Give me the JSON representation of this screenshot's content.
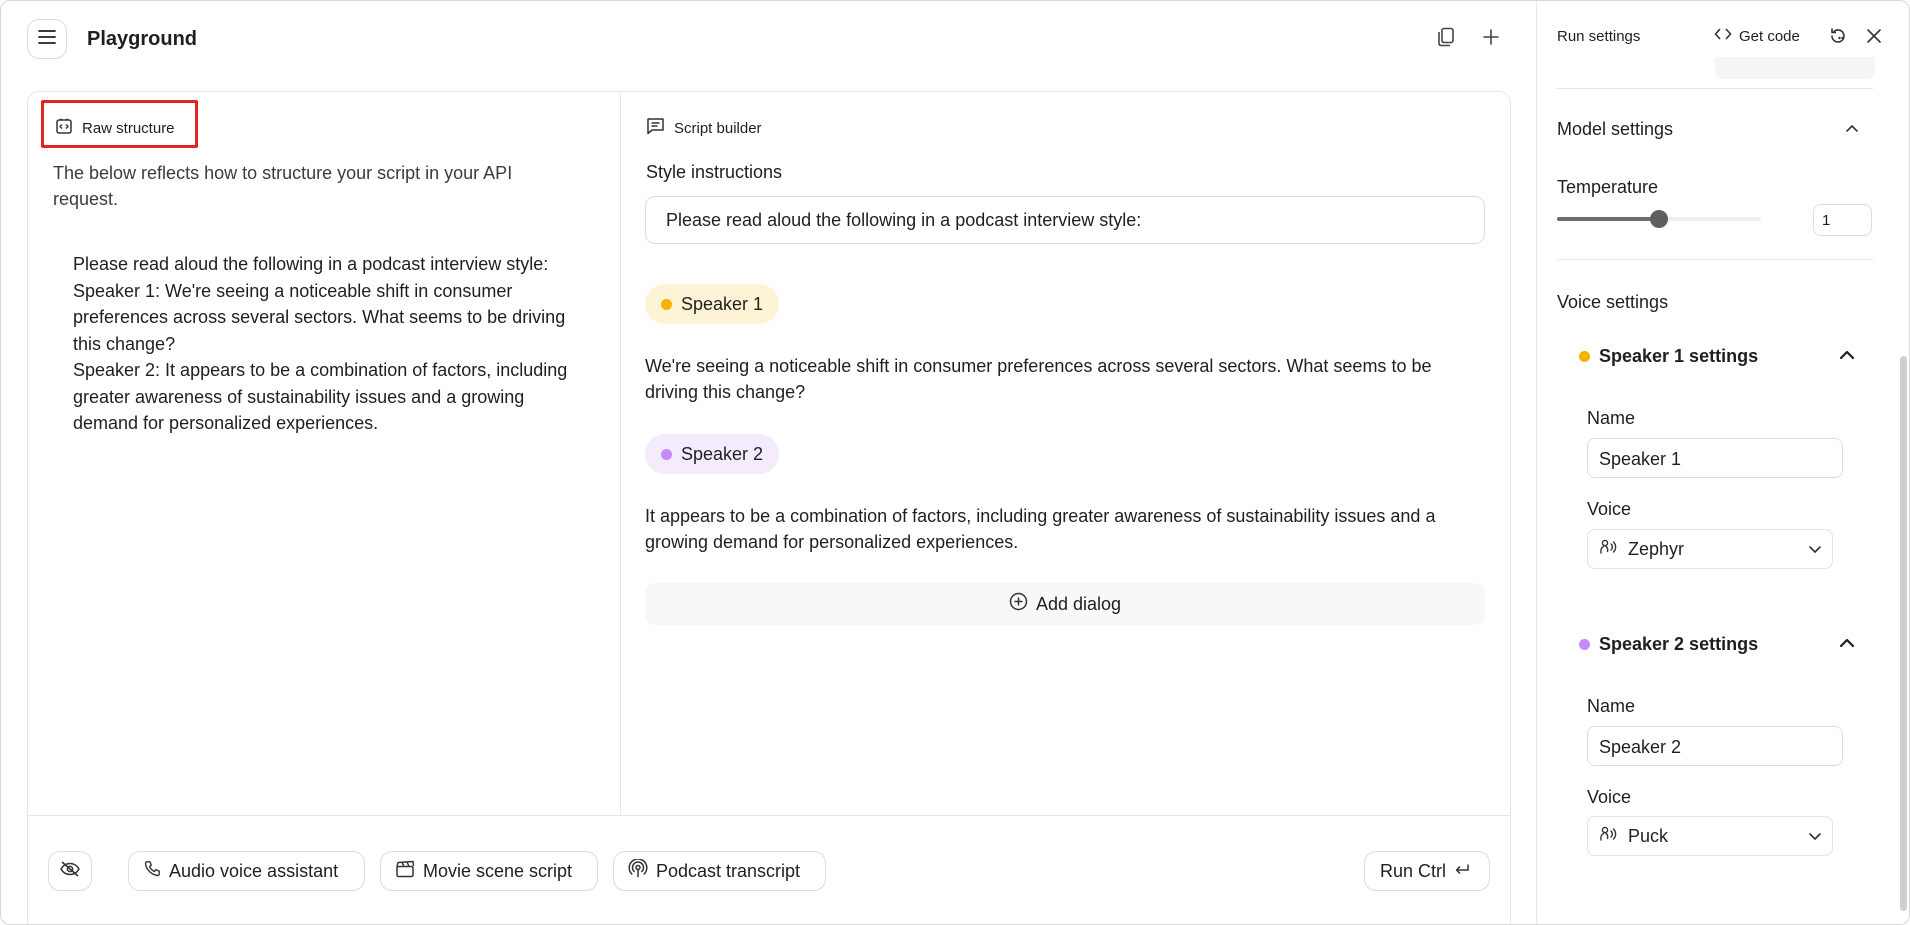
{
  "header": {
    "title": "Playground"
  },
  "left_panel": {
    "tab_label": "Raw structure",
    "intro": "The below reflects how to structure your script in your API request.",
    "raw_lines": [
      "Please read aloud the following in a podcast interview style:",
      "Speaker 1: We're seeing a noticeable shift in consumer preferences across several sectors. What seems to be driving this change?",
      "Speaker 2: It appears to be a combination of factors, including greater awareness of sustainability issues and a growing demand for personalized experiences."
    ]
  },
  "script_builder": {
    "tab_label": "Script builder",
    "style_label": "Style instructions",
    "style_value": "Please read aloud the following in a podcast interview style:",
    "dialogs": [
      {
        "speaker": "Speaker 1",
        "color": "#f5b400",
        "chip_bg": "#fdf3d6",
        "text": "We're seeing a noticeable shift in consumer preferences across several sectors. What seems to be driving this change?"
      },
      {
        "speaker": "Speaker 2",
        "color": "#c58af9",
        "chip_bg": "#f4ecfd",
        "text": "It appears to be a combination of factors, including greater awareness of sustainability issues and a growing demand for personalized experiences."
      }
    ],
    "add_dialog_label": "Add dialog"
  },
  "bottom_bar": {
    "audio_voice_assistant": "Audio voice assistant",
    "movie_scene_script": "Movie scene script",
    "podcast_transcript": "Podcast transcript",
    "run_label": "Run Ctrl"
  },
  "run_settings": {
    "title": "Run settings",
    "get_code": "Get code",
    "model_settings": {
      "heading": "Model settings",
      "temperature_label": "Temperature",
      "temperature_value": "1",
      "temperature_fraction": 0.5
    },
    "voice_settings": {
      "heading": "Voice settings",
      "speakers": [
        {
          "heading": "Speaker 1 settings",
          "color": "#f5b400",
          "name_label": "Name",
          "name_value": "Speaker 1",
          "voice_label": "Voice",
          "voice_value": "Zephyr"
        },
        {
          "heading": "Speaker 2 settings",
          "color": "#c58af9",
          "name_label": "Name",
          "name_value": "Speaker 2",
          "voice_label": "Voice",
          "voice_value": "Puck"
        }
      ]
    }
  },
  "icons": {
    "menu": "menu-icon",
    "copy": "copy-icon",
    "add": "plus-icon",
    "code": "code-icon",
    "reset": "reset-icon",
    "close": "close-icon",
    "raw": "raw-structure-icon",
    "script": "script-builder-icon",
    "add_circle": "add-circle-icon",
    "hide": "visibility-off-icon",
    "phone": "phone-icon",
    "movie": "clapperboard-icon",
    "podcast": "podcast-icon",
    "enter": "enter-key-icon",
    "voice": "voice-icon",
    "chevron": "chevron-icon"
  }
}
